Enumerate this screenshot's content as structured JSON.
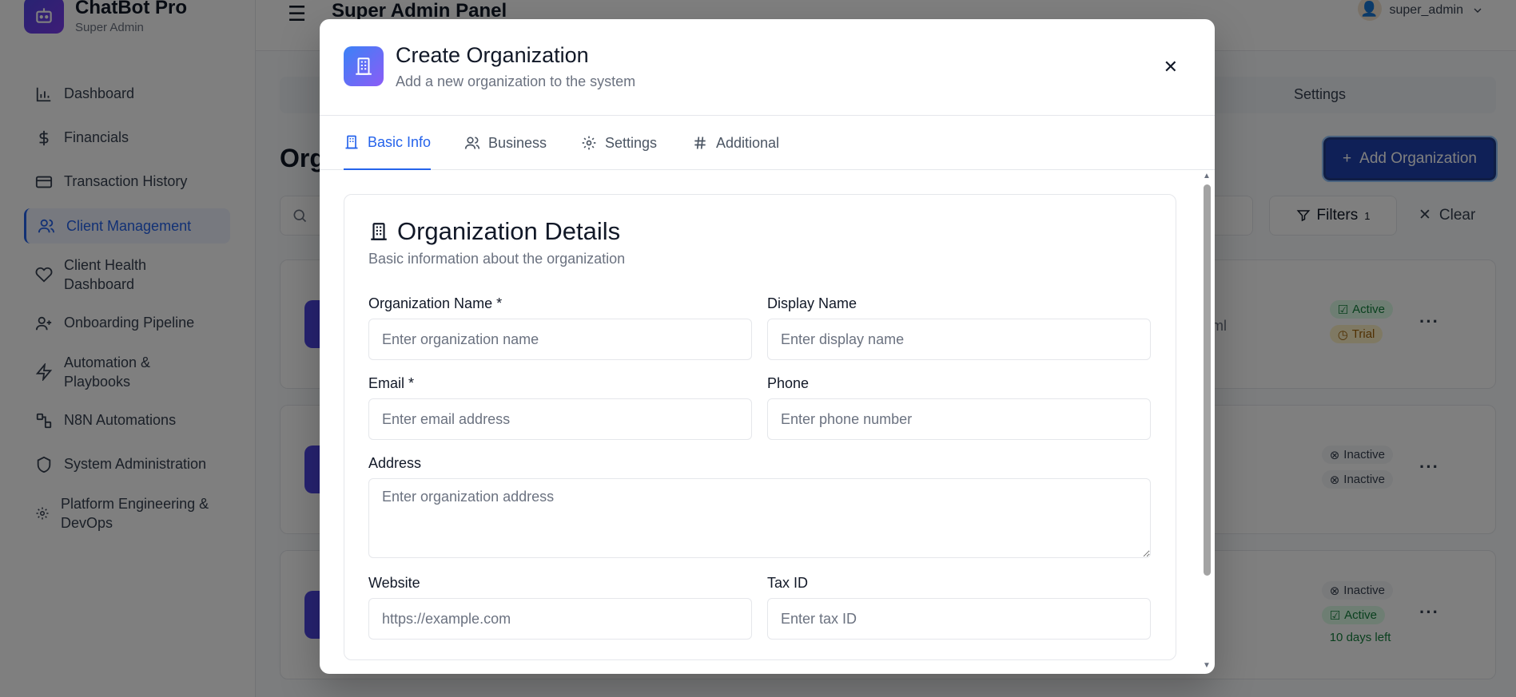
{
  "app": {
    "name": "ChatBot Pro",
    "role": "Super Admin"
  },
  "sidebar": {
    "items": [
      {
        "label": "Dashboard",
        "icon": "bar-chart-icon"
      },
      {
        "label": "Financials",
        "icon": "dollar-icon"
      },
      {
        "label": "Transaction History",
        "icon": "credit-card-icon"
      },
      {
        "label": "Client Management",
        "icon": "users-icon",
        "active": true
      },
      {
        "label": "Client Health Dashboard",
        "icon": "heart-icon"
      },
      {
        "label": "Onboarding Pipeline",
        "icon": "user-plus-icon"
      },
      {
        "label": "Automation & Playbooks",
        "icon": "zap-icon"
      },
      {
        "label": "N8N Automations",
        "icon": "workflow-icon"
      },
      {
        "label": "System Administration",
        "icon": "shield-icon"
      },
      {
        "label": "Platform Engineering & DevOps",
        "icon": "gear-icon"
      }
    ]
  },
  "topbar": {
    "title": "Super Admin Panel",
    "user": "super_admin"
  },
  "background": {
    "tab_settings": "Settings",
    "heading_fragment": "Org",
    "add_button": "Add Organization",
    "filters_label": "Filters",
    "filters_count": "1",
    "clear_label": "Clear",
    "cards": [
      {
        "url_fragment": "tml",
        "badges": [
          {
            "text": "Active",
            "kind": "active"
          },
          {
            "text": "Trial",
            "kind": "trial"
          }
        ],
        "note": ""
      },
      {
        "url_fragment": "",
        "badges": [
          {
            "text": "Inactive",
            "kind": "inactive"
          },
          {
            "text": "Inactive",
            "kind": "inactive"
          }
        ],
        "note": ""
      },
      {
        "url_fragment": "",
        "badges": [
          {
            "text": "Inactive",
            "kind": "inactive"
          },
          {
            "text": "Active",
            "kind": "active"
          }
        ],
        "note": "10 days left"
      }
    ]
  },
  "modal": {
    "title": "Create Organization",
    "subtitle": "Add a new organization to the system",
    "tabs": [
      {
        "label": "Basic Info",
        "icon": "building-icon"
      },
      {
        "label": "Business",
        "icon": "users-icon"
      },
      {
        "label": "Settings",
        "icon": "gear-icon"
      },
      {
        "label": "Additional",
        "icon": "hash-icon"
      }
    ],
    "section": {
      "title": "Organization Details",
      "subtitle": "Basic information about the organization"
    },
    "fields": {
      "org_name": {
        "label": "Organization Name *",
        "placeholder": "Enter organization name",
        "value": ""
      },
      "display_name": {
        "label": "Display Name",
        "placeholder": "Enter display name",
        "value": ""
      },
      "email": {
        "label": "Email *",
        "placeholder": "Enter email address",
        "value": ""
      },
      "phone": {
        "label": "Phone",
        "placeholder": "Enter phone number",
        "value": ""
      },
      "address": {
        "label": "Address",
        "placeholder": "Enter organization address",
        "value": ""
      },
      "website": {
        "label": "Website",
        "placeholder": "https://example.com",
        "value": ""
      },
      "tax_id": {
        "label": "Tax ID",
        "placeholder": "Enter tax ID",
        "value": ""
      }
    }
  },
  "colors": {
    "accent": "#2563eb",
    "brand": "#4f46e5",
    "active": "#15803d",
    "trial": "#a16207"
  }
}
